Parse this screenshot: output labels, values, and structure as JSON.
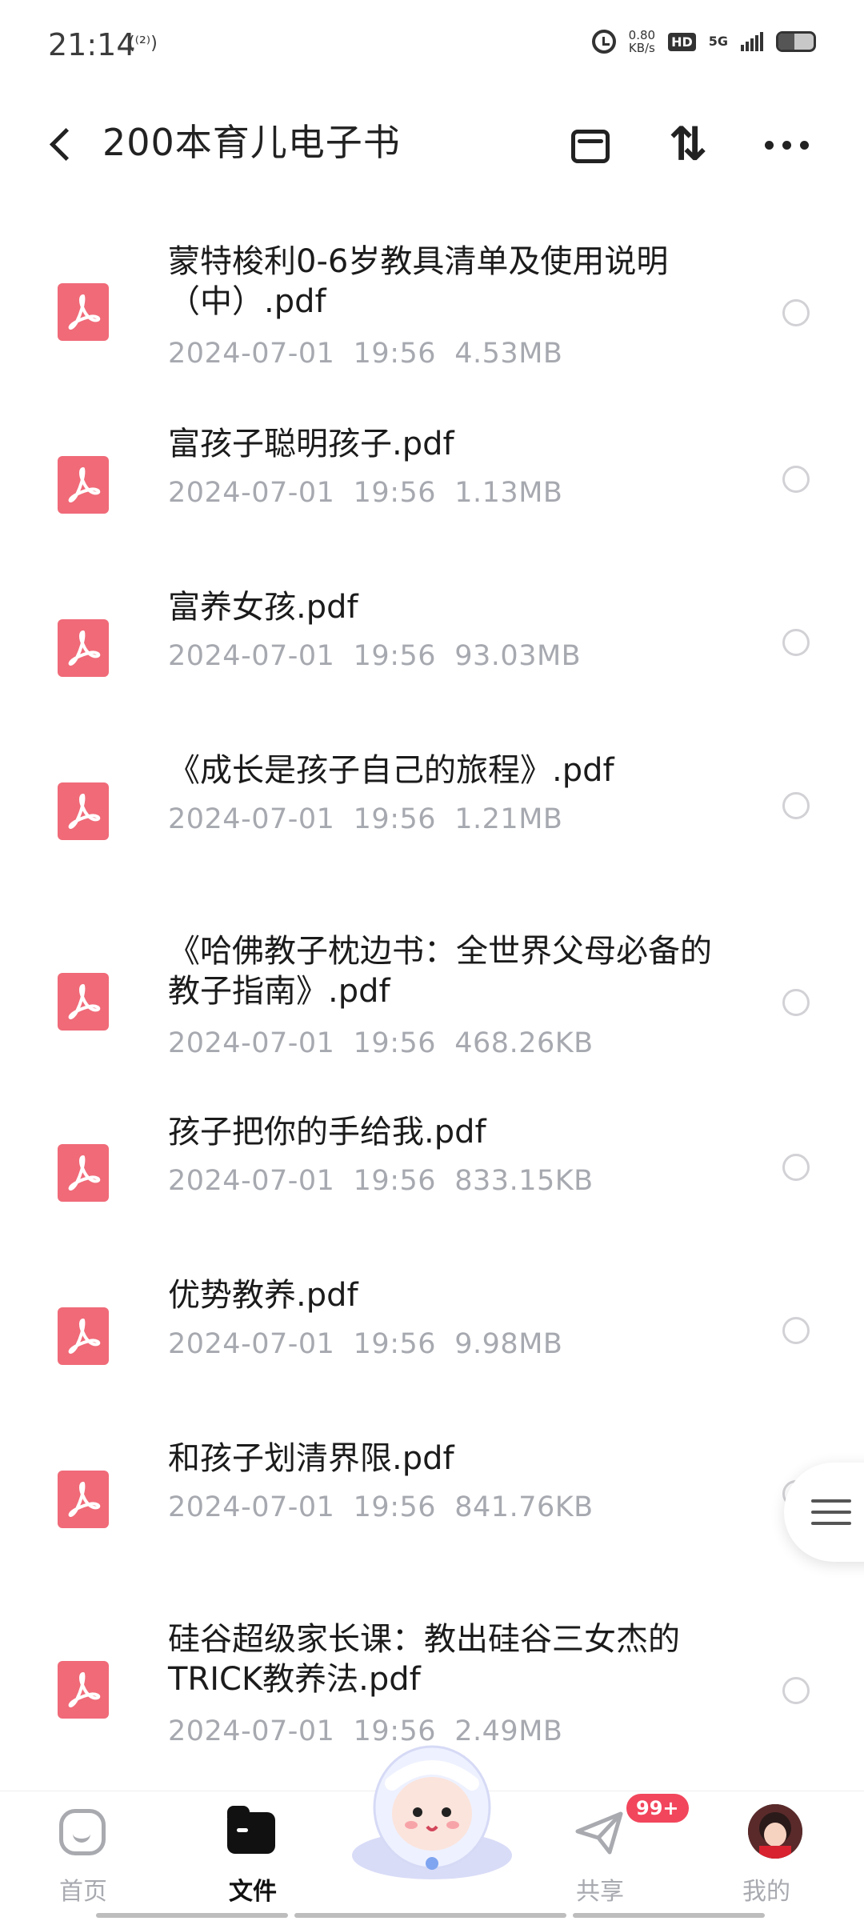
{
  "status_bar": {
    "time": "21:14",
    "wifi_call": "(⁽²⁾)",
    "net_speed_value": "0.80",
    "net_speed_unit": "KB/s",
    "hd_label": "HD",
    "network": "5G",
    "battery_level": 0.45
  },
  "header": {
    "title": "200本育儿电子书",
    "sort_glyph": "⇅"
  },
  "files": [
    {
      "name": "蒙特梭利0-6岁教具清单及使用说明（中）.pdf",
      "meta": "2024-07-01  19:56  4.53MB"
    },
    {
      "name": "富孩子聪明孩子.pdf",
      "meta": "2024-07-01  19:56  1.13MB"
    },
    {
      "name": "富养女孩.pdf",
      "meta": "2024-07-01  19:56  93.03MB"
    },
    {
      "name": "《成长是孩子自己的旅程》.pdf",
      "meta": "2024-07-01  19:56  1.21MB"
    },
    {
      "name": "《哈佛教子枕边书：全世界父母必备的教子指南》.pdf",
      "meta": "2024-07-01  19:56  468.26KB"
    },
    {
      "name": "孩子把你的手给我.pdf",
      "meta": "2024-07-01  19:56  833.15KB"
    },
    {
      "name": "优势教养.pdf",
      "meta": "2024-07-01  19:56  9.98MB"
    },
    {
      "name": "和孩子划清界限.pdf",
      "meta": "2024-07-01  19:56  841.76KB"
    },
    {
      "name": "硅谷超级家长课：教出硅谷三女杰的TRICK教养法.pdf",
      "meta": "2024-07-01  19:56  2.49MB"
    }
  ],
  "nav": {
    "home": "首页",
    "files": "文件",
    "share": "共享",
    "share_badge": "99+",
    "mine": "我的"
  },
  "colors": {
    "pdf_icon": "#f06a78",
    "meta_text": "#a7a9b0",
    "badge": "#f2465c"
  },
  "icons": [
    "back-arrow-icon",
    "archive-icon",
    "sort-icon",
    "more-icon",
    "pdf-icon",
    "menu-icon",
    "home-icon",
    "folder-icon",
    "mascot-icon",
    "send-icon",
    "avatar"
  ]
}
